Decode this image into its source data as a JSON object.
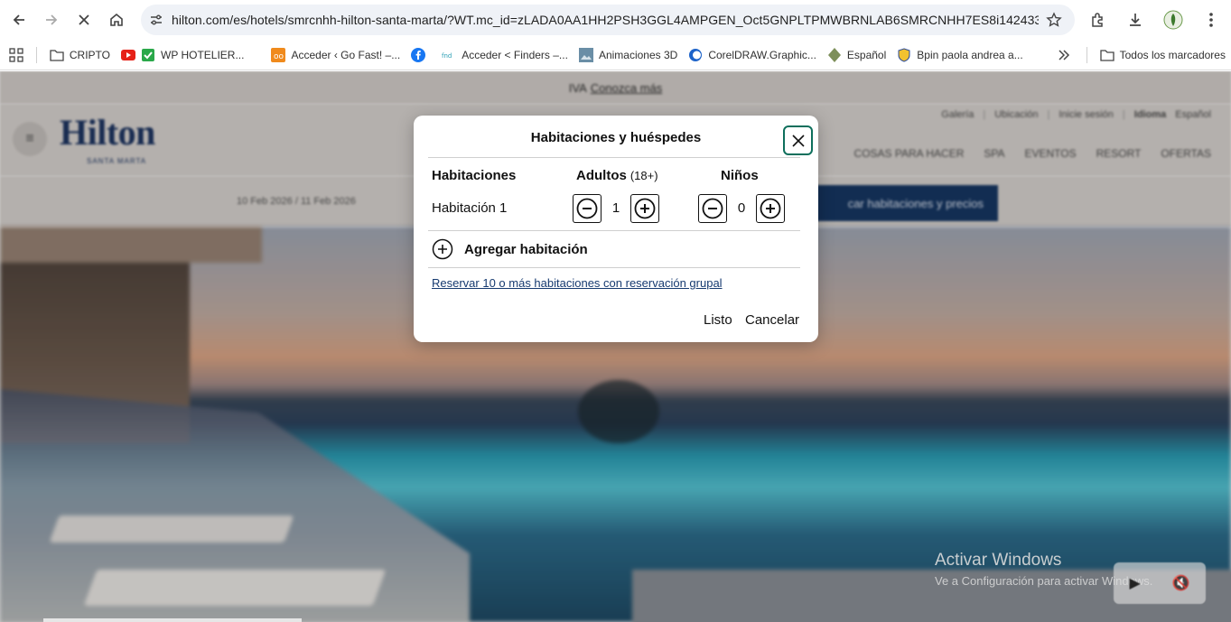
{
  "browser": {
    "url": "hilton.com/es/hotels/smrcnhh-hilton-santa-marta/?WT.mc_id=zLADA0AA1HH2PSH3GGL4AMPGEN_Oct5GNPLTPMWBRNLAB6SMRCNHH7ES8i142433__z...",
    "bookmarks": [
      {
        "label": "CRIPTO",
        "icon": "folder-icon"
      },
      {
        "label": "WP HOTELIER...",
        "icon": "youtube-check-icon"
      },
      {
        "label": "Acceder ‹ Go Fast! –...",
        "icon": "site-icon"
      },
      {
        "label": "",
        "icon": "facebook-icon"
      },
      {
        "label": "Acceder < Finders –...",
        "icon": "finders-icon"
      },
      {
        "label": "Animaciones 3D",
        "icon": "image-icon"
      },
      {
        "label": "CorelDRAW.Graphic...",
        "icon": "corel-icon"
      },
      {
        "label": "Español",
        "icon": "diamond-icon"
      },
      {
        "label": "Bpin paola andrea a...",
        "icon": "shield-icon"
      }
    ],
    "all_bookmarks_label": "Todos los marcadores"
  },
  "page": {
    "banner_text": "IVA",
    "banner_link": "Conozca más",
    "logo": "Hilton",
    "logo_sub": "SANTA MARTA",
    "util_links": [
      "Galería",
      "Ubicación",
      "Inicie sesión",
      "Idioma",
      "Español"
    ],
    "nav_items": [
      "COSAS PARA HACER",
      "SPA",
      "EVENTOS",
      "RESORT",
      "OFERTAS"
    ],
    "dates_text": "10 Feb 2026  /  11 Feb 2026",
    "cta_label": "car habitaciones y precios"
  },
  "modal": {
    "title": "Habitaciones y huéspedes",
    "col_rooms": "Habitaciones",
    "col_adults": "Adultos",
    "col_adults_sub": "(18+)",
    "col_children": "Niños",
    "room_label": "Habitación 1",
    "adults_value": "1",
    "children_value": "0",
    "add_room": "Agregar habitación",
    "group_link": "Reservar 10 o más habitaciones con reservación grupal",
    "done": "Listo",
    "cancel": "Cancelar"
  },
  "os": {
    "watermark_title": "Activar Windows",
    "watermark_sub": "Ve a Configuración para activar Windows."
  },
  "colors": {
    "close_border": "#0e6f5c",
    "link": "#163a70",
    "brand": "#1d3563",
    "cta": "#173865"
  }
}
